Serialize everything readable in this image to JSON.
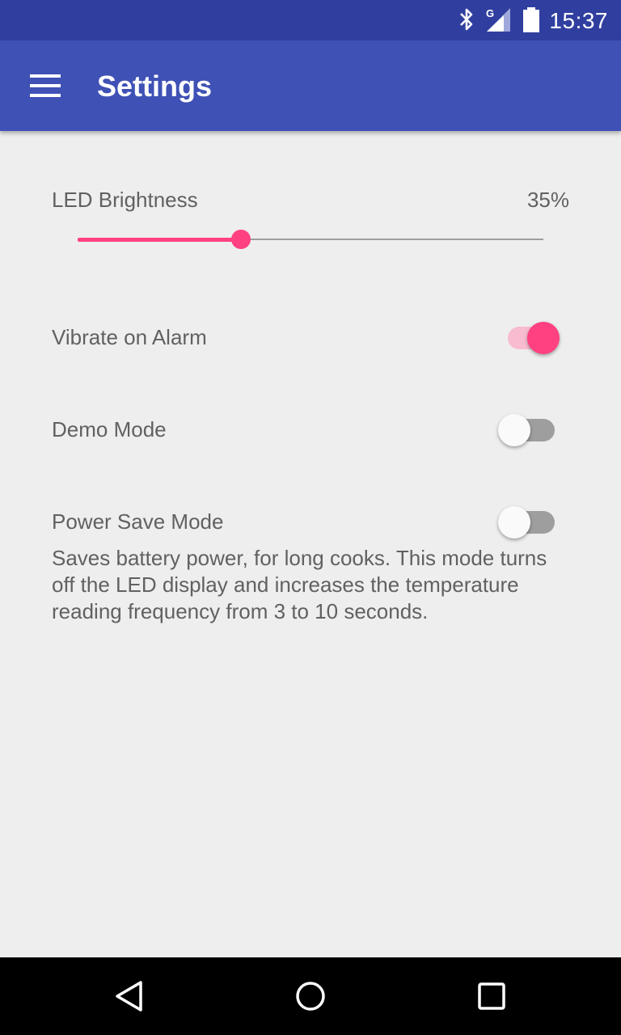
{
  "status_bar": {
    "time": "15:37",
    "network_type": "G",
    "icons": [
      "bluetooth-icon",
      "signal-icon",
      "battery-icon"
    ]
  },
  "app_bar": {
    "title": "Settings",
    "menu_icon": "hamburger-menu-icon"
  },
  "settings": {
    "led_brightness": {
      "label": "LED Brightness",
      "value_text": "35%",
      "value_fraction": 0.35
    },
    "vibrate_on_alarm": {
      "label": "Vibrate on Alarm",
      "enabled": true
    },
    "demo_mode": {
      "label": "Demo Mode",
      "enabled": false
    },
    "power_save_mode": {
      "label": "Power Save Mode",
      "enabled": false,
      "description": "Saves battery power, for long cooks. This mode turns off the LED display and increases the temperature reading frequency from 3 to 10 seconds."
    }
  },
  "nav_bar": {
    "icons": [
      "back-icon",
      "home-icon",
      "recents-icon"
    ]
  },
  "colors": {
    "status_bar": "#303f9f",
    "app_bar": "#3f51b5",
    "accent": "#ff4081",
    "accent_light": "#f8bbd0",
    "background": "#eeeeee",
    "text": "#616161"
  }
}
